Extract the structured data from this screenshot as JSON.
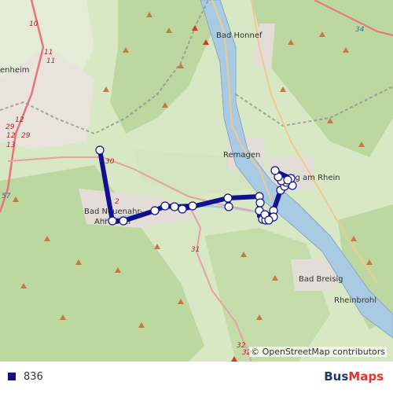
{
  "map": {
    "places": [
      "Bad Honnef",
      "Remagen",
      "Bad Neuenahr-",
      "Ahrweiler",
      "Sinzig am Rhein",
      "Bad Breisig",
      "Rheinbrohl",
      "enheim"
    ],
    "road_labels": [
      "10",
      "11",
      "11",
      "12",
      "29",
      "12",
      "13",
      "29",
      "30",
      "31",
      "32",
      "32",
      "34",
      "57",
      "2"
    ],
    "attribution": "© OpenStreetMap contributors"
  },
  "route": {
    "color": "#101090",
    "stop_count": 28
  },
  "legend": {
    "route_number": "836",
    "swatch_color": "#101090"
  },
  "brand": {
    "part1": "Bus",
    "part2": "Maps"
  }
}
